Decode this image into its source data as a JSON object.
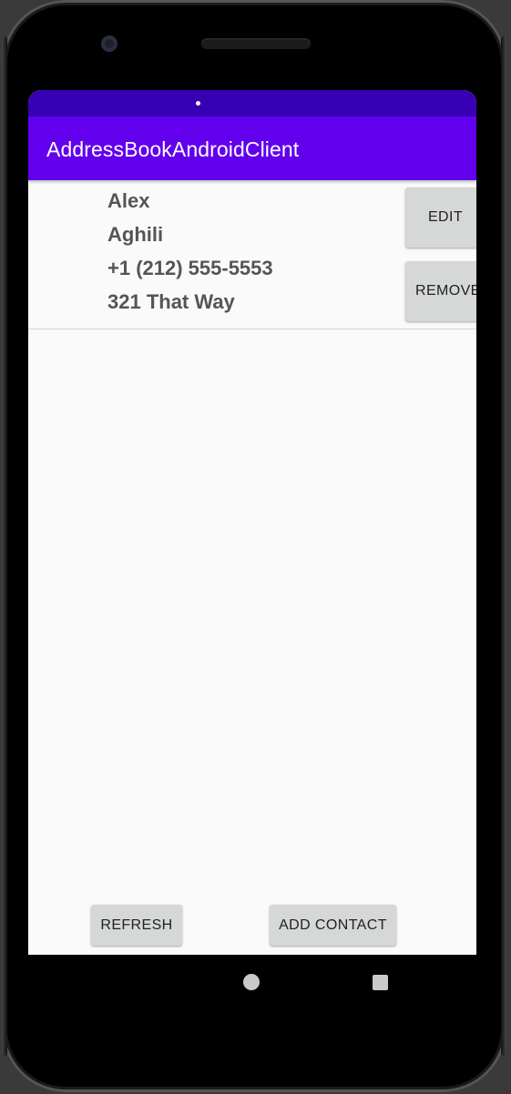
{
  "app": {
    "title": "AddressBookAndroidClient"
  },
  "colors": {
    "status_bar": "#3700b3",
    "app_bar": "#6200ee",
    "background": "#fafafa",
    "button": "#d6d7d7",
    "contact_text": "#555555"
  },
  "contacts": [
    {
      "first_name": "Alex",
      "last_name": "Aghili",
      "phone": "+1 (212) 555-5553",
      "address": "321 That Way",
      "edit_label": "EDIT",
      "remove_label": "REMOVE"
    }
  ],
  "footer": {
    "refresh_label": "REFRESH",
    "add_contact_label": "ADD CONTACT"
  },
  "navigation": {
    "home_icon": "circle-home-icon",
    "recents_icon": "square-recents-icon"
  }
}
